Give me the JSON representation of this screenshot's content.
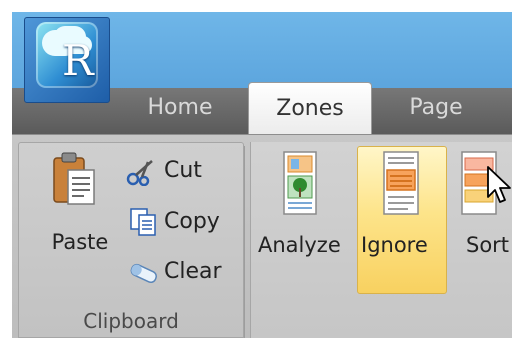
{
  "app": {
    "icon": "app-logo-icon",
    "logo_letter": "R"
  },
  "tabs": [
    {
      "label": "Home",
      "selected": false
    },
    {
      "label": "Zones",
      "selected": true
    },
    {
      "label": "Page",
      "selected": false
    }
  ],
  "clipboard": {
    "group_label": "Clipboard",
    "paste_label": "Paste",
    "paste_icon": "clipboard-paste-icon",
    "cut_label": "Cut",
    "cut_icon": "scissors-icon",
    "copy_label": "Copy",
    "copy_icon": "copy-icon",
    "clear_label": "Clear",
    "clear_icon": "eraser-icon"
  },
  "zones": {
    "analyze_label": "Analyze",
    "analyze_icon": "analyze-zone-icon",
    "ignore_label": "Ignore",
    "ignore_icon": "ignore-zone-icon",
    "ignore_hovered": true,
    "sort_label": "Sort",
    "sort_icon": "sort-zone-icon"
  },
  "colors": {
    "title_bar": "#5aa3dc",
    "tab_strip": "#666666",
    "ribbon": "#c4c4c4",
    "hover_highlight": "#fde48a"
  }
}
